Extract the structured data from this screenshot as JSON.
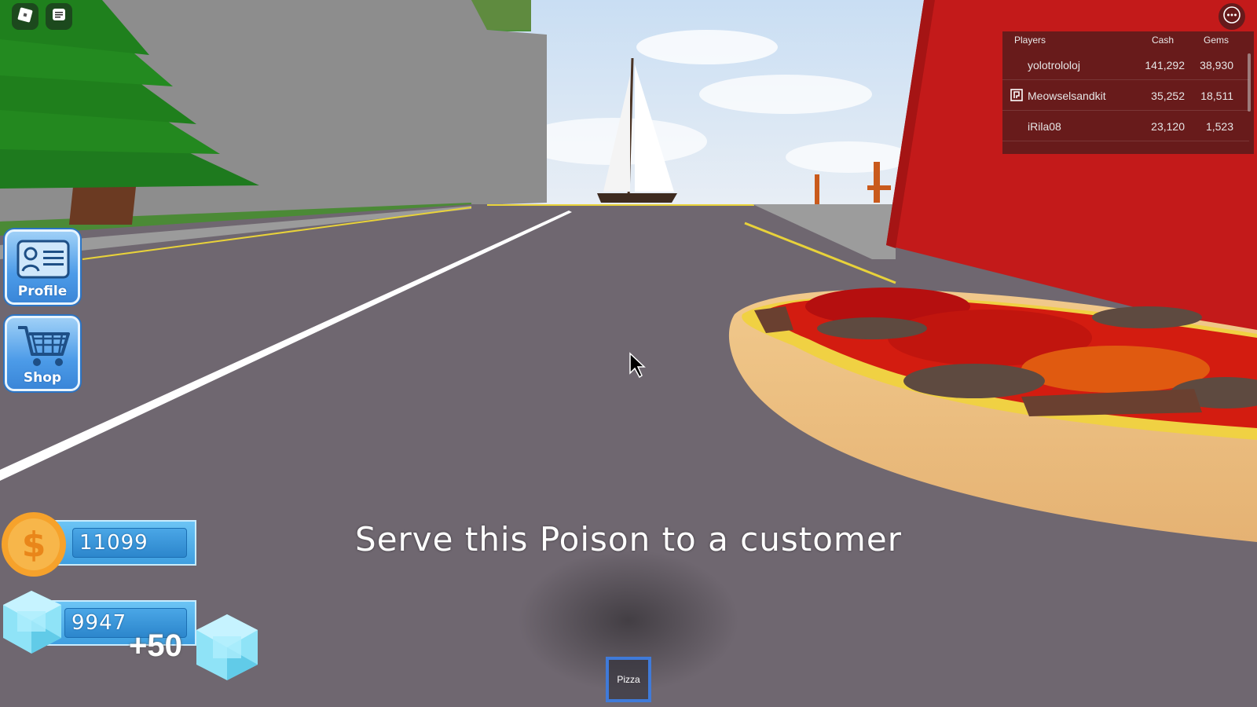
{
  "leaderboard": {
    "headers": {
      "players": "Players",
      "cash": "Cash",
      "gems": "Gems"
    },
    "rows": [
      {
        "name": "yolotrololoj",
        "cash": "141,292",
        "gems": "38,930"
      },
      {
        "name": "Meowselsandkit",
        "cash": "35,252",
        "gems": "18,511"
      },
      {
        "name": "iRila08",
        "cash": "23,120",
        "gems": "1,523"
      }
    ]
  },
  "side_buttons": {
    "profile": "Profile",
    "shop": "Shop"
  },
  "currency": {
    "cash": "11099",
    "gems": "9947",
    "gem_gain": "+50"
  },
  "hint": "Serve this Poison to a customer",
  "hotbar": [
    {
      "label": "Pizza",
      "selected": true
    }
  ],
  "colors": {
    "ui_blue": "#4c9be8",
    "coin": "#f5a623",
    "slot_border": "#3f7ad9"
  }
}
